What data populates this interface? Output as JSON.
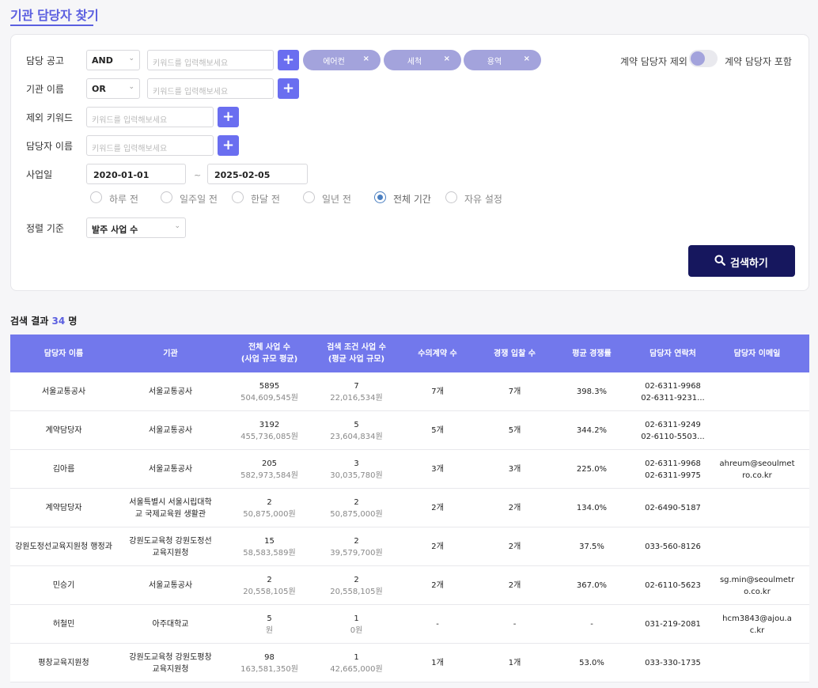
{
  "page_title": "기관 담당자 찾기",
  "filters": {
    "notice": {
      "label": "담당 공고",
      "operator": "AND",
      "placeholder": "키워드를 입력해보세요",
      "chips": [
        {
          "text": "에어컨"
        },
        {
          "text": "세척"
        },
        {
          "text": "용역"
        }
      ]
    },
    "agency": {
      "label": "기관 이름",
      "operator": "OR",
      "placeholder": "키워드를 입력해보세요"
    },
    "exclude": {
      "label": "제외 키워드",
      "placeholder": "키워드를 입력해보세요"
    },
    "manager": {
      "label": "담당자 이름",
      "placeholder": "키워드를 입력해보세요"
    },
    "date": {
      "label": "사업일",
      "start": "2020-01-01",
      "separator": "~",
      "end": "2025-02-05",
      "options": [
        "하루 전",
        "일주일 전",
        "한달 전",
        "일년 전",
        "전체 기간",
        "자유 설정"
      ],
      "selected": "전체 기간"
    },
    "sort": {
      "label": "정렬 기준",
      "value": "발주 사업 수"
    },
    "toggle": {
      "left_label": "계약 담당자 제외",
      "right_label": "계약 담당자 포함"
    },
    "plus_symbol": "+",
    "remove_symbol": "×",
    "chevron_symbol": "⌄",
    "search_button": "검색하기"
  },
  "results": {
    "label_prefix": "검색 결과",
    "count": "34",
    "label_suffix": "명",
    "headers": [
      {
        "line1": "담당자 이름",
        "line2": ""
      },
      {
        "line1": "기관",
        "line2": ""
      },
      {
        "line1": "전체 사업 수",
        "line2": "(사업 규모 평균)"
      },
      {
        "line1": "검색 조건 사업 수",
        "line2": "(평균 사업 규모)"
      },
      {
        "line1": "수의계약 수",
        "line2": ""
      },
      {
        "line1": "경쟁 입찰 수",
        "line2": ""
      },
      {
        "line1": "평균 경쟁률",
        "line2": ""
      },
      {
        "line1": "담당자 연락처",
        "line2": ""
      },
      {
        "line1": "담당자 이메일",
        "line2": ""
      }
    ],
    "rows": [
      {
        "name": "서울교통공사",
        "agency": "서울교통공사",
        "total": "5895",
        "total_avg": "504,609,545원",
        "cond": "7",
        "cond_avg": "22,016,534원",
        "private": "7개",
        "bid": "7개",
        "rate": "398.3%",
        "phone1": "02-6311-9968",
        "phone2": "02-6311-9231...",
        "email": ""
      },
      {
        "name": "계약담당자",
        "agency": "서울교통공사",
        "total": "3192",
        "total_avg": "455,736,085원",
        "cond": "5",
        "cond_avg": "23,604,834원",
        "private": "5개",
        "bid": "5개",
        "rate": "344.2%",
        "phone1": "02-6311-9249",
        "phone2": "02-6110-5503...",
        "email": ""
      },
      {
        "name": "김아름",
        "agency": "서울교통공사",
        "total": "205",
        "total_avg": "582,973,584원",
        "cond": "3",
        "cond_avg": "30,035,780원",
        "private": "3개",
        "bid": "3개",
        "rate": "225.0%",
        "phone1": "02-6311-9968",
        "phone2": "02-6311-9975",
        "email": "ahreum@seoulmetro.co.kr"
      },
      {
        "name": "계약담당자",
        "agency": "서울특별시 서울시립대학교 국제교육원 생활관",
        "total": "2",
        "total_avg": "50,875,000원",
        "cond": "2",
        "cond_avg": "50,875,000원",
        "private": "2개",
        "bid": "2개",
        "rate": "134.0%",
        "phone1": "02-6490-5187",
        "phone2": "",
        "email": ""
      },
      {
        "name": "강원도정선교육지원청 행정과",
        "agency": "강원도교육청 강원도정선교육지원청",
        "total": "15",
        "total_avg": "58,583,589원",
        "cond": "2",
        "cond_avg": "39,579,700원",
        "private": "2개",
        "bid": "2개",
        "rate": "37.5%",
        "phone1": "033-560-8126",
        "phone2": "",
        "email": ""
      },
      {
        "name": "민승기",
        "agency": "서울교통공사",
        "total": "2",
        "total_avg": "20,558,105원",
        "cond": "2",
        "cond_avg": "20,558,105원",
        "private": "2개",
        "bid": "2개",
        "rate": "367.0%",
        "phone1": "02-6110-5623",
        "phone2": "",
        "email": "sg.min@seoulmetro.co.kr"
      },
      {
        "name": "허철민",
        "agency": "아주대학교",
        "total": "5",
        "total_avg": "원",
        "cond": "1",
        "cond_avg": "0원",
        "private": "-",
        "bid": "-",
        "rate": "-",
        "phone1": "031-219-2081",
        "phone2": "",
        "email": "hcm3843@ajou.ac.kr"
      },
      {
        "name": "평창교육지원청",
        "agency": "강원도교육청 강원도평창교육지원청",
        "total": "98",
        "total_avg": "163,581,350원",
        "cond": "1",
        "cond_avg": "42,665,000원",
        "private": "1개",
        "bid": "1개",
        "rate": "53.0%",
        "phone1": "033-330-1735",
        "phone2": "",
        "email": ""
      }
    ]
  }
}
